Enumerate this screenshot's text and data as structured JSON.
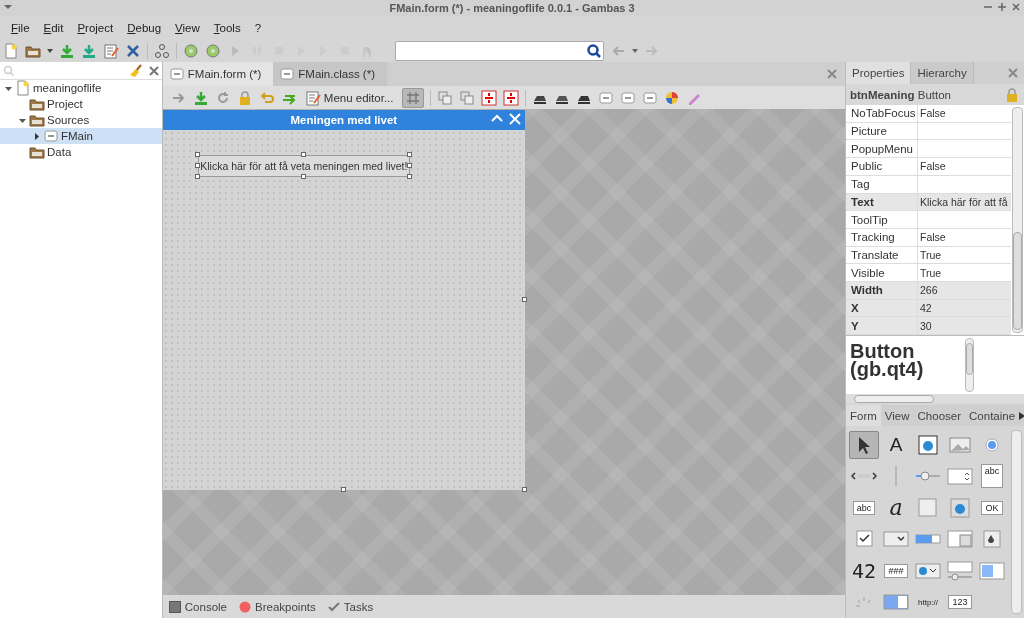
{
  "window": {
    "title": "FMain.form (*) - meaningoflife 0.0.1 - Gambas 3"
  },
  "menu": [
    "File",
    "Edit",
    "Project",
    "Debug",
    "View",
    "Tools",
    "?"
  ],
  "project_tree": [
    {
      "label": "meaningoflife",
      "expanded": true,
      "selected": false,
      "children": [
        {
          "label": "Project",
          "selected": false
        },
        {
          "label": "Sources",
          "expanded": true,
          "selected": false,
          "children": [
            {
              "label": "FMain",
              "expanded": false,
              "selected": true
            }
          ]
        },
        {
          "label": "Data",
          "selected": false
        }
      ]
    }
  ],
  "editor_tabs": [
    {
      "label": "FMain.form (*)",
      "selected": true
    },
    {
      "label": "FMain.class (*)",
      "selected": false
    }
  ],
  "form_toolbar": {
    "menu_editor": "Menu editor...",
    "grid_on": true
  },
  "form": {
    "title": "Meningen med livet",
    "button": "Klicka här för att få veta meningen med livet!"
  },
  "bottom_tabs": [
    {
      "label": "Console",
      "kind": "console"
    },
    {
      "label": "Breakpoints",
      "kind": "breakpoints"
    },
    {
      "label": "Tasks",
      "kind": "tasks"
    }
  ],
  "side_tabs": [
    {
      "label": "Properties",
      "selected": true
    },
    {
      "label": "Hierarchy",
      "selected": false
    }
  ],
  "properties": {
    "object": "btnMeaning",
    "class": "Button",
    "rows": [
      {
        "name": "NoTabFocus",
        "value": "False",
        "modified": false
      },
      {
        "name": "Picture",
        "modified": false
      },
      {
        "name": "PopupMenu",
        "modified": false
      },
      {
        "name": "Public",
        "value": "False",
        "modified": false
      },
      {
        "name": "Tag",
        "modified": false
      },
      {
        "name": "Text",
        "value": "Klicka här för att få",
        "modified": true
      },
      {
        "name": "ToolTip",
        "modified": false
      },
      {
        "name": "Tracking",
        "value": "False",
        "modified": false
      },
      {
        "name": "Translate",
        "value": "True",
        "modified": false
      },
      {
        "name": "Visible",
        "value": "True",
        "modified": false
      },
      {
        "name": "Width",
        "value": "266",
        "modified": true
      },
      {
        "name": "X",
        "value": "42",
        "modified": true
      },
      {
        "name": "Y",
        "value": "30",
        "modified": true
      }
    ]
  },
  "help": {
    "title": "Button (gb.qt4)"
  },
  "toolbox": {
    "tabs": [
      {
        "label": "Form",
        "selected": true
      },
      {
        "label": "View",
        "selected": false
      },
      {
        "label": "Chooser",
        "selected": false
      },
      {
        "label": "Containe",
        "selected": false
      }
    ],
    "tools": [
      {
        "kind": "pointer",
        "selected": true
      },
      {
        "kind": "glyph",
        "label": "A",
        "selected": false
      },
      {
        "kind": "movie",
        "selected": false
      },
      {
        "kind": "image",
        "selected": false
      },
      {
        "kind": "radio",
        "selected": false
      },
      {
        "kind": "scrollbar",
        "selected": false
      },
      {
        "kind": "separator",
        "selected": false
      },
      {
        "kind": "slider",
        "selected": false
      },
      {
        "kind": "spin",
        "selected": false
      },
      {
        "kind": "textarea",
        "label": "abc",
        "selected": false
      },
      {
        "kind": "field",
        "label": "abc",
        "selected": false
      },
      {
        "kind": "italic",
        "label": "a",
        "selected": false
      },
      {
        "kind": "frame",
        "selected": false
      },
      {
        "kind": "picture",
        "selected": false
      },
      {
        "kind": "field",
        "label": "OK",
        "selected": false
      },
      {
        "kind": "checkbox",
        "selected": false
      },
      {
        "kind": "combo",
        "selected": false
      },
      {
        "kind": "progress",
        "selected": false
      },
      {
        "kind": "filechooser",
        "selected": false
      },
      {
        "kind": "color",
        "selected": false
      },
      {
        "kind": "lcd",
        "label": "42",
        "selected": false
      },
      {
        "kind": "field",
        "label": "###",
        "selected": false
      },
      {
        "kind": "iconcombo",
        "selected": false
      },
      {
        "kind": "spinslider",
        "selected": false
      },
      {
        "kind": "colorspin",
        "selected": false
      },
      {
        "kind": "spinner",
        "selected": false
      },
      {
        "kind": "switch",
        "selected": false
      },
      {
        "kind": "small",
        "label": "http://",
        "selected": false
      },
      {
        "kind": "field",
        "label": "123",
        "selected": false
      }
    ]
  }
}
